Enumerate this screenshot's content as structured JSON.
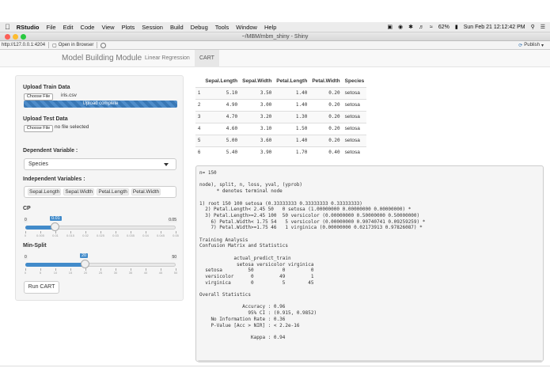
{
  "menubar": {
    "app": "RStudio",
    "items": [
      "File",
      "Edit",
      "Code",
      "View",
      "Plots",
      "Session",
      "Build",
      "Debug",
      "Tools",
      "Window",
      "Help"
    ],
    "battery": "62%",
    "datetime": "Sun Feb 21  12:12:42 PM"
  },
  "window": {
    "title": "~/MBM/mbm_shiny - Shiny"
  },
  "toolbar": {
    "url": "http://127.0.0.1:4204",
    "open_browser": "Open in Browser",
    "publish": "Publish"
  },
  "navbar": {
    "brand": "Model Building Module",
    "tabs": [
      "Linear Regression",
      "CART"
    ],
    "active_tab": "CART"
  },
  "sidebar": {
    "train_label": "Upload Train Data",
    "choose_file": "Choose File",
    "train_file": "iris.csv",
    "upload_status": "Upload complete",
    "upload_progress": 1.0,
    "test_label": "Upload Test Data",
    "test_file": "no file selected",
    "dep_label": "Dependent Variable :",
    "dep_value": "Species",
    "indep_label": "Independent Variables :",
    "indep_values": [
      "Sepal.Length",
      "Sepal.Width",
      "Petal.Length",
      "Petal.Width"
    ],
    "cp": {
      "label": "CP",
      "min": "0",
      "max": "0.05",
      "value": "0.01",
      "value_num": 0.01,
      "range": [
        0,
        0.05
      ],
      "ticks": [
        "0",
        "0.005",
        "0.01",
        "0.015",
        "0.02",
        "0.025",
        "0.03",
        "0.035",
        "0.04",
        "0.045",
        "0.05"
      ]
    },
    "minsplit": {
      "label": "Min-Split",
      "min": "0",
      "max": "50",
      "value": "20",
      "value_num": 20,
      "range": [
        0,
        50
      ],
      "ticks": [
        "0",
        "5",
        "10",
        "15",
        "20",
        "25",
        "30",
        "35",
        "40",
        "45",
        "50"
      ]
    },
    "run_button": "Run CART"
  },
  "table": {
    "headers": [
      "",
      "Sepal.Length",
      "Sepal.Width",
      "Petal.Length",
      "Petal.Width",
      "Species"
    ],
    "rows": [
      [
        "1",
        "5.10",
        "3.50",
        "1.40",
        "0.20",
        "setosa"
      ],
      [
        "2",
        "4.90",
        "3.00",
        "1.40",
        "0.20",
        "setosa"
      ],
      [
        "3",
        "4.70",
        "3.20",
        "1.30",
        "0.20",
        "setosa"
      ],
      [
        "4",
        "4.60",
        "3.10",
        "1.50",
        "0.20",
        "setosa"
      ],
      [
        "5",
        "5.00",
        "3.60",
        "1.40",
        "0.20",
        "setosa"
      ],
      [
        "6",
        "5.40",
        "3.90",
        "1.70",
        "0.40",
        "setosa"
      ]
    ]
  },
  "output": {
    "text": "n= 150\n\nnode), split, n, loss, yval, (yprob)\n      * denotes terminal node\n\n1) root 150 100 setosa (0.33333333 0.33333333 0.33333333)\n  2) Petal.Length< 2.45 50   0 setosa (1.00000000 0.00000000 0.00000000) *\n  3) Petal.Length>=2.45 100  50 versicolor (0.00000000 0.50000000 0.50000000)\n    6) Petal.Width< 1.75 54   5 versicolor (0.00000000 0.90740741 0.09259259) *\n    7) Petal.Width>=1.75 46   1 virginica (0.00000000 0.02173913 0.97826087) *\n\nTraining Analysis\nConfusion Matrix and Statistics\n\n            actual_predict_train\n             setosa versicolor virginica\n  setosa         50          0         0\n  versicolor      0         49         1\n  virginica       0          5        45\n\nOverall Statistics\n\n               Accuracy : 0.96\n                 95% CI : (0.915, 0.9852)\n    No Information Rate : 0.36\n    P-Value [Acc > NIR] : < 2.2e-16\n\n                  Kappa : 0.94"
  },
  "colors": {
    "accent": "#428bca",
    "panel": "#f5f5f5"
  }
}
